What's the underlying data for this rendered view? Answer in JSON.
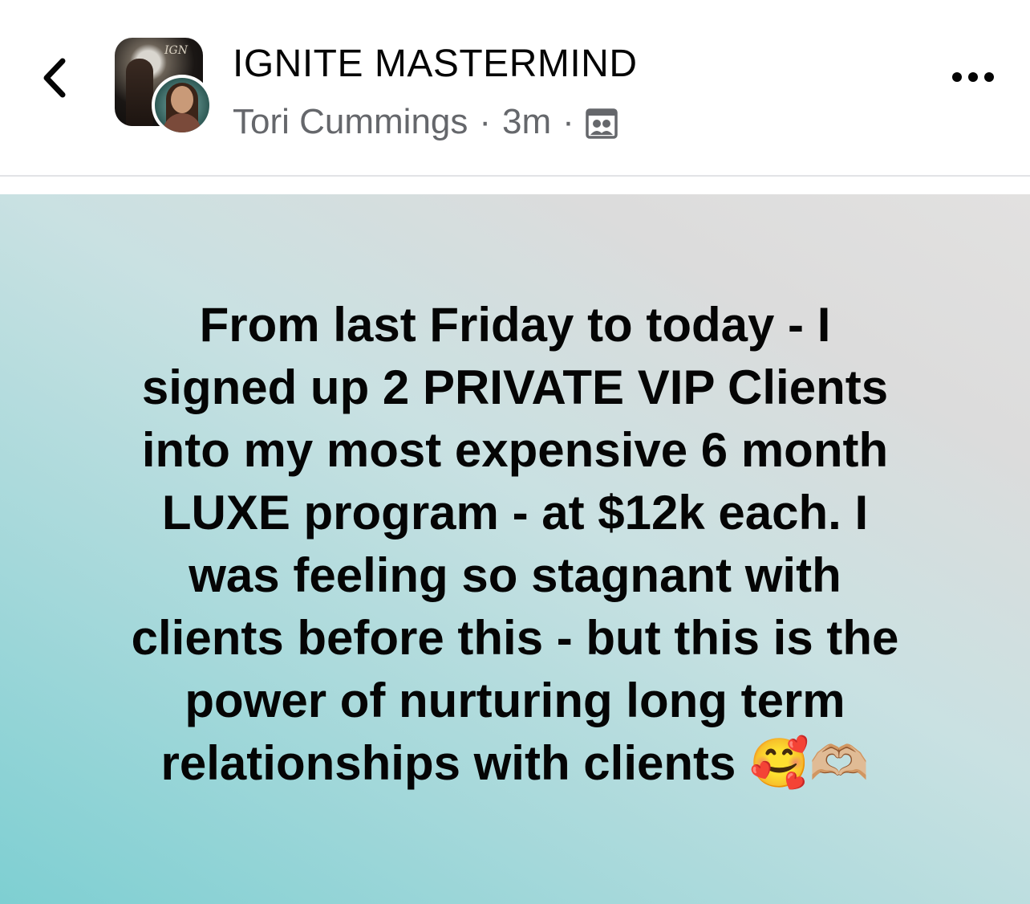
{
  "header": {
    "back_icon": "chevron-left-icon",
    "group_avatar_text": "IGN",
    "group_name": "IGNITE MASTERMIND",
    "author_name": "Tori Cummings",
    "separator": "·",
    "timestamp": "3m",
    "audience_icon": "group-members-icon",
    "more_icon": "more-horizontal-icon"
  },
  "post": {
    "text": "From last Friday to today - I\nsigned up 2 PRIVATE VIP Clients\ninto my most expensive 6 month\nLUXE program - at $12k each. I\nwas feeling so stagnant with\nclients before this - but this is the\npower of nurturing long term\nrelationships with clients 🥰🫶🏼",
    "background_colors": [
      "#7ecfd2",
      "#c9e1e2",
      "#e2e1e0"
    ],
    "text_color": "#050505"
  }
}
